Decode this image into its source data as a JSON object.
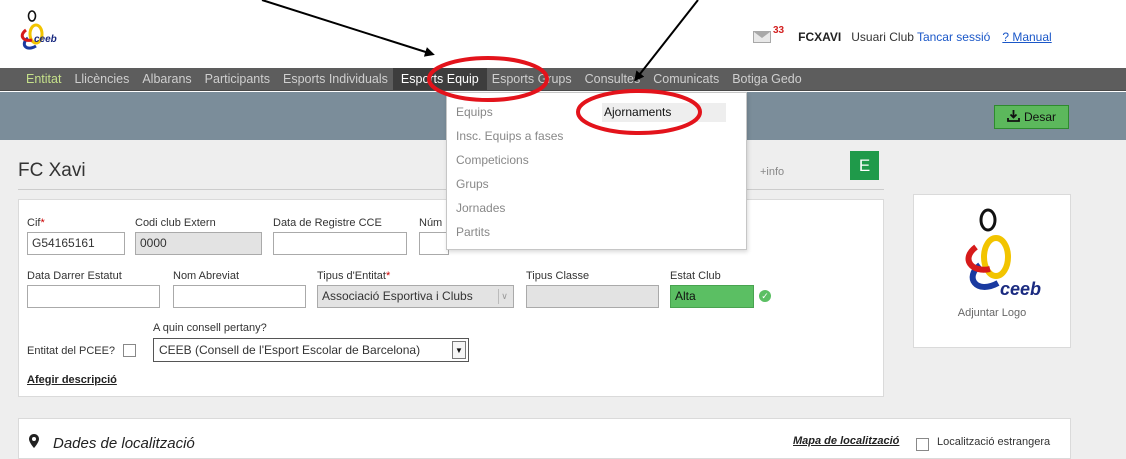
{
  "header": {
    "logo_text": "ceeb",
    "mail_count": "33",
    "user_code": "FCXAVI",
    "user_role": "Usuari Club",
    "logout_label": "Tancar sessió",
    "manual_label": "? Manual"
  },
  "nav": {
    "items": [
      {
        "label": "Entitat"
      },
      {
        "label": "Llicències"
      },
      {
        "label": "Albarans"
      },
      {
        "label": "Participants"
      },
      {
        "label": "Esports Individuals"
      },
      {
        "label": "Esports Equip"
      },
      {
        "label": "Esports Grups"
      },
      {
        "label": "Consultes"
      },
      {
        "label": "Comunicats"
      },
      {
        "label": "Botiga Gedo"
      }
    ],
    "active": "Esports Equip"
  },
  "toolbar": {
    "save_label": "Desar"
  },
  "dropdown": {
    "items": [
      {
        "label": "Equips"
      },
      {
        "label": "Insc. Equips a fases"
      },
      {
        "label": "Competicions"
      },
      {
        "label": "Grups"
      },
      {
        "label": "Jornades"
      },
      {
        "label": "Partits"
      }
    ],
    "submenu_label": "Ajornaments"
  },
  "entity": {
    "name": "FC Xavi",
    "more_info": "+info",
    "status_letter": "E"
  },
  "form": {
    "cif_label": "Cif",
    "cif_value": "G54165161",
    "codi_label": "Codi club Extern",
    "codi_value": "0000",
    "data_registre_label": "Data de Registre CCE",
    "data_registre_value": "",
    "num_label": "Núm",
    "num_value": "",
    "data_estatut_label": "Data Darrer Estatut",
    "data_estatut_value": "",
    "nom_abreviat_label": "Nom Abreviat",
    "nom_abreviat_value": "",
    "tipus_entitat_label": "Tipus d'Entitat",
    "tipus_entitat_value": "Associació Esportiva i Clubs",
    "tipus_classe_label": "Tipus Classe",
    "tipus_classe_value": "",
    "estat_label": "Estat Club",
    "estat_value": "Alta",
    "pcee_label": "Entitat del PCEE?",
    "consell_label": "A quin consell pertany?",
    "consell_value": "CEEB (Consell de l'Esport Escolar de Barcelona)",
    "add_desc_label": "Afegir descripció"
  },
  "logo_card": {
    "brand": "ceeb",
    "caption": "Adjuntar Logo"
  },
  "location": {
    "title": "Dades de localització",
    "map_link": "Mapa de localització",
    "foreign_label": "Localització estrangera"
  },
  "annotation_colors": {
    "highlight_ring": "#e3131b",
    "arrow": "#000000"
  }
}
